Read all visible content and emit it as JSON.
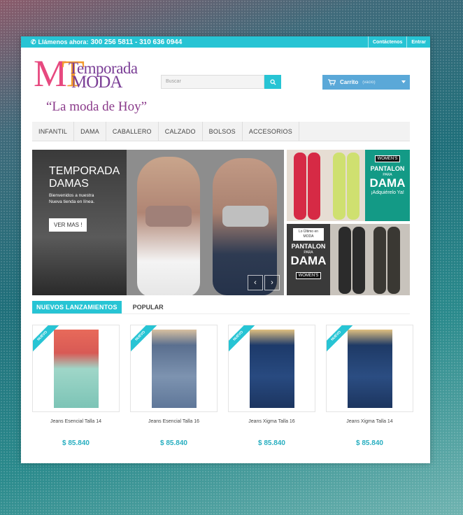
{
  "topbar": {
    "phone_label": "Llámenos ahora:",
    "phone_numbers": "300 256 5811 - 310 636 0944",
    "links": [
      "Contáctenos",
      "Entrar"
    ]
  },
  "logo": {
    "brand_line1": "Temporada",
    "brand_line2": "MODA",
    "tagline": "“La moda de Hoy”"
  },
  "search": {
    "placeholder": "Buscar"
  },
  "cart": {
    "label": "Carrito",
    "status": "(vacío)"
  },
  "nav": {
    "items": [
      "INFANTIL",
      "DAMA",
      "CABALLERO",
      "CALZADO",
      "BOLSOS",
      "ACCESORIOS"
    ]
  },
  "slider": {
    "title_line1": "TEMPORADA",
    "title_line2": "DAMAS",
    "subtitle": "Bienvenidos a nuestra Nueva tienda en línea.",
    "button": "VER MAS !"
  },
  "promo1": {
    "tag": "WOMEN'S",
    "line1": "PANTALON",
    "line2": "PARA",
    "line3": "DAMA",
    "cta": "¡Adquiérelo Ya!"
  },
  "promo2": {
    "badge": "Lo Último en MODA",
    "line1": "PANTALON",
    "line2": "PARA",
    "line3": "DAMA",
    "tag": "WOMEN'S"
  },
  "tabs": {
    "active": "NUEVOS LANZAMIENTOS",
    "other": "POPULAR"
  },
  "ribbon": "NUEVO",
  "products": [
    {
      "name": "Jeans Esencial Talla 14",
      "price": "$ 85.840"
    },
    {
      "name": "Jeans Esencial Talla 16",
      "price": "$ 85.840"
    },
    {
      "name": "Jeans Xigma Talla 16",
      "price": "$ 85.840"
    },
    {
      "name": "Jeans Xigma Talla 14",
      "price": "$ 85.840"
    }
  ],
  "colors": {
    "accent": "#27c4d4",
    "cart": "#5aa8d8",
    "logo_purple": "#7a3e96",
    "price": "#27aec0"
  }
}
